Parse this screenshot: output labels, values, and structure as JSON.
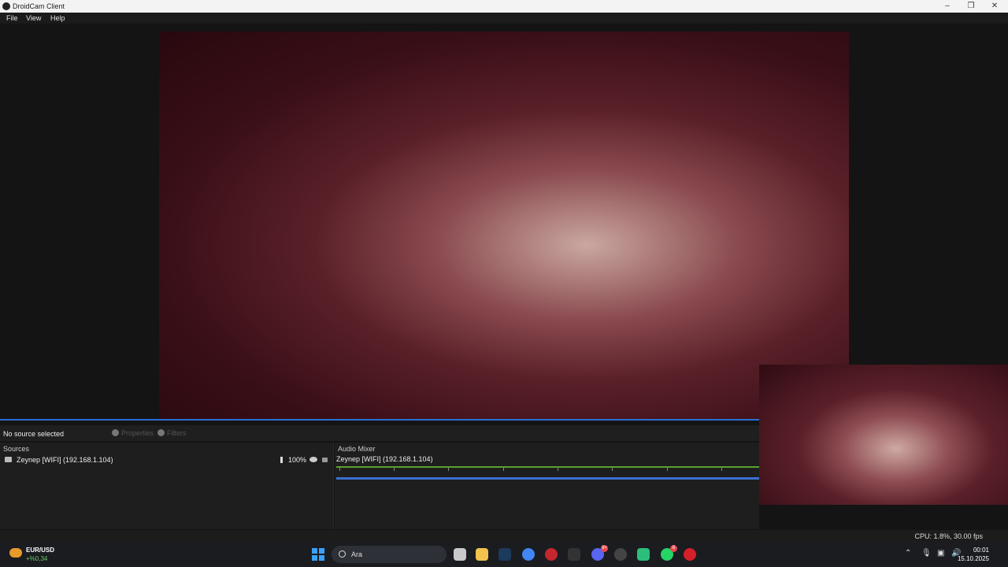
{
  "window": {
    "title": "DroidCam Client",
    "controls": [
      "–",
      "❐",
      "✕"
    ]
  },
  "menu": [
    "File",
    "View",
    "Help"
  ],
  "toolbar": {
    "no_source": "No source selected",
    "properties": "Properties",
    "filters": "Filters"
  },
  "sources": {
    "header": "Sources",
    "item_name": "Zeynep [WIFI] (192.168.1.104)",
    "volume": "100%"
  },
  "mixer": {
    "header": "Audio Mixer",
    "channel": "Zeynep [WIFI] (192.168.1.104)",
    "scale": [
      "-60",
      "-50",
      "-40",
      "-30",
      "-20",
      "-15",
      "-10",
      "-5",
      "0"
    ]
  },
  "status": {
    "cpu": "CPU: 1.8%, 30.00 fps"
  },
  "taskbar": {
    "fx_pair": "EUR/USD",
    "fx_change": "+%0,34",
    "search_placeholder": "Ara",
    "discord_badge": "9+",
    "whatsapp_badge": "6",
    "time": "00:01",
    "date": "15.10.2025"
  }
}
